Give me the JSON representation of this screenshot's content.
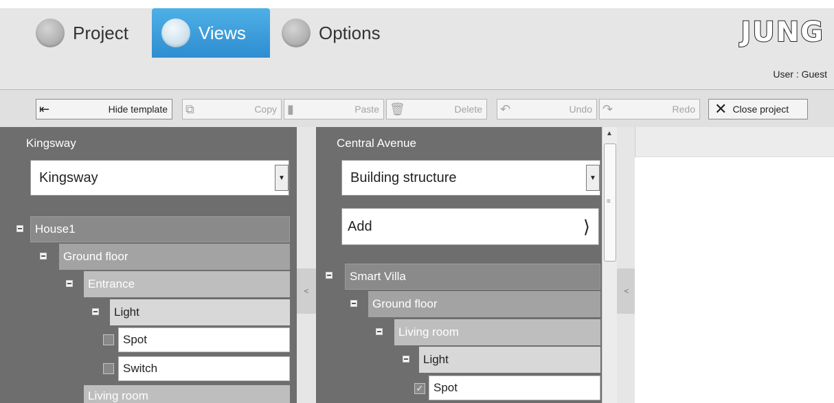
{
  "header": {
    "tabs": [
      {
        "label": "Project",
        "active": false
      },
      {
        "label": "Views",
        "active": true
      },
      {
        "label": "Options",
        "active": false
      }
    ],
    "logo": "JUNG",
    "user": "User : Guest",
    "accent_color": "#3a9ad9"
  },
  "toolbar": {
    "hide_template": "Hide template",
    "copy": "Copy",
    "paste": "Paste",
    "delete": "Delete",
    "undo": "Undo",
    "redo": "Redo",
    "close_project": "Close project"
  },
  "left_panel": {
    "title": "Kingsway",
    "dropdown_value": "Kingsway",
    "tree": [
      {
        "label": "House1",
        "level": 0
      },
      {
        "label": "Ground floor",
        "level": 1
      },
      {
        "label": "Entrance",
        "level": 2
      },
      {
        "label": "Light",
        "level": 3
      },
      {
        "label": "Spot",
        "checked": false
      },
      {
        "label": "Switch",
        "checked": false
      },
      {
        "label": "Living room",
        "level": 2
      }
    ]
  },
  "center_panel": {
    "title": "Central Avenue",
    "dropdown_value": "Building structure",
    "add_label": "Add",
    "tree": [
      {
        "label": "Smart Villa",
        "level": 0
      },
      {
        "label": "Ground floor",
        "level": 1
      },
      {
        "label": "Living room",
        "level": 2
      },
      {
        "label": "Light",
        "level": 3
      },
      {
        "label": "Spot",
        "checked": true
      }
    ]
  }
}
